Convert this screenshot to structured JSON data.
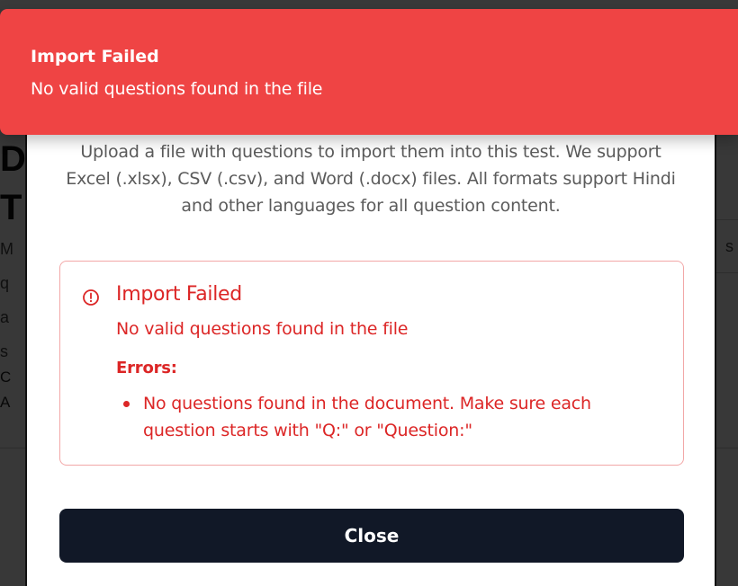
{
  "toast": {
    "title": "Import Failed",
    "message": "No valid questions found in the file"
  },
  "modal": {
    "description": "Upload a file with questions to import them into this test. We support Excel (.xlsx), CSV (.csv), and Word (.docx) files. All formats support Hindi and other languages for all question content.",
    "error": {
      "title": "Import Failed",
      "message": "No valid questions found in the file",
      "errors_label": "Errors:",
      "items": [
        "No questions found in the document. Make sure each question starts with \"Q:\" or \"Question:\""
      ]
    },
    "close_label": "Close"
  },
  "colors": {
    "toast_bg": "#ef4444",
    "error_text": "#dc2626",
    "close_btn_bg": "#111827"
  }
}
